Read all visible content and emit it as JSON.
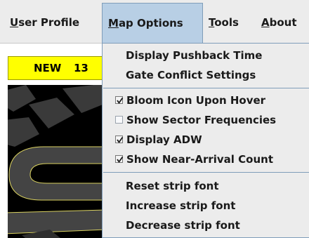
{
  "menubar": {
    "items": [
      {
        "mnemonic": "U",
        "rest": "ser Profile"
      },
      {
        "mnemonic": "M",
        "rest": "ap Options"
      },
      {
        "mnemonic": "T",
        "rest": "ools"
      },
      {
        "mnemonic": "A",
        "rest": "bout"
      }
    ]
  },
  "app": {
    "badge": {
      "label": "NEW",
      "count": "13"
    }
  },
  "map_options_menu": {
    "items": [
      {
        "label": "Display Pushback Time",
        "submenu": true
      },
      {
        "label": "Gate Conflict Settings"
      },
      {
        "label": "Bloom Icon Upon Hover",
        "checked": true
      },
      {
        "label": "Show Sector Frequencies",
        "checked": false
      },
      {
        "label": "Display ADW",
        "checked": true
      },
      {
        "label": "Show Near-Arrival Count",
        "checked": true
      },
      {
        "label": "Reset strip font"
      },
      {
        "label": "Increase strip font"
      },
      {
        "label": "Decrease strip font"
      }
    ]
  },
  "colors": {
    "menu_highlight": "#b8cfe5",
    "badge": "#ffff00",
    "map_background": "#000000",
    "taxiway_line": "#d8d060"
  }
}
